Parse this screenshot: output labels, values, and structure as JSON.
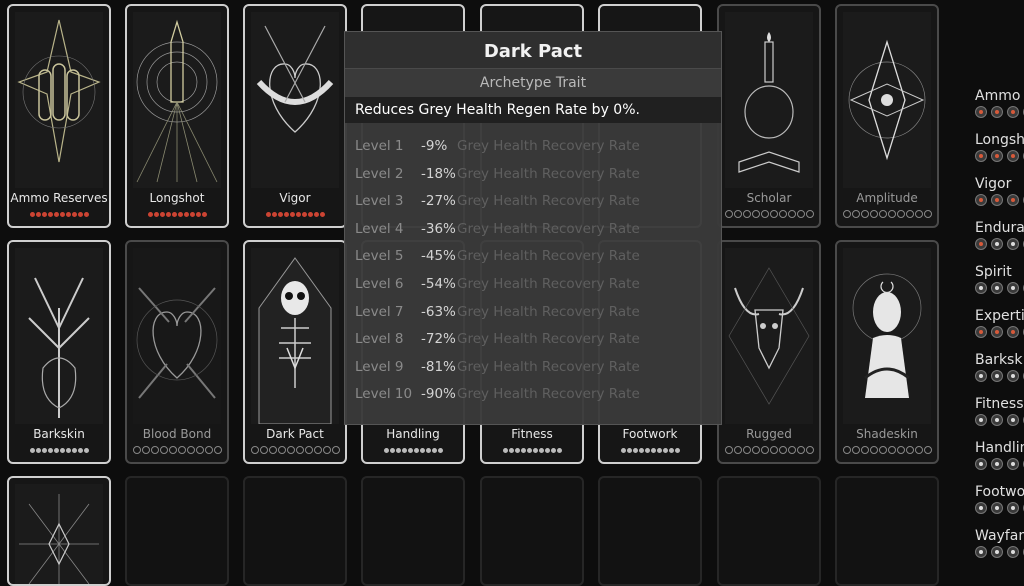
{
  "cards": [
    {
      "id": "ammo",
      "name": "Ammo Reserves",
      "state": "owned",
      "pips": "red10"
    },
    {
      "id": "longshot",
      "name": "Longshot",
      "state": "owned",
      "pips": "red10"
    },
    {
      "id": "vigor",
      "name": "Vigor",
      "state": "owned",
      "pips": "red10"
    },
    {
      "id": "hidden4",
      "name": "",
      "state": "owned",
      "pips": ""
    },
    {
      "id": "hidden5",
      "name": "",
      "state": "owned",
      "pips": ""
    },
    {
      "id": "hidden6",
      "name": "",
      "state": "owned",
      "pips": ""
    },
    {
      "id": "scholar",
      "name": "Scholar",
      "state": "unowned",
      "pips": "empty10"
    },
    {
      "id": "amplitude",
      "name": "Amplitude",
      "state": "unowned",
      "pips": "empty10"
    },
    {
      "id": "barkskin",
      "name": "Barkskin",
      "state": "owned",
      "pips": "small10"
    },
    {
      "id": "bloodbond",
      "name": "Blood Bond",
      "state": "unowned",
      "pips": "empty10"
    },
    {
      "id": "darkpact",
      "name": "Dark Pact",
      "state": "selected",
      "pips": "empty10"
    },
    {
      "id": "handling",
      "name": "Handling",
      "state": "owned",
      "pips": "small10"
    },
    {
      "id": "fitness",
      "name": "Fitness",
      "state": "owned",
      "pips": "small10"
    },
    {
      "id": "footwork",
      "name": "Footwork",
      "state": "owned",
      "pips": "small10"
    },
    {
      "id": "rugged",
      "name": "Rugged",
      "state": "unowned",
      "pips": "empty10"
    },
    {
      "id": "shadeskin",
      "name": "Shadeskin",
      "state": "unowned",
      "pips": "empty10"
    }
  ],
  "tooltip": {
    "title": "Dark Pact",
    "subtitle": "Archetype Trait",
    "description": "Reduces Grey Health Regen Rate by 0%.",
    "levels": [
      {
        "label": "Level 1",
        "value": "-9%",
        "desc": "Grey Health Recovery Rate"
      },
      {
        "label": "Level 2",
        "value": "-18%",
        "desc": "Grey Health Recovery Rate"
      },
      {
        "label": "Level 3",
        "value": "-27%",
        "desc": "Grey Health Recovery Rate"
      },
      {
        "label": "Level 4",
        "value": "-36%",
        "desc": "Grey Health Recovery Rate"
      },
      {
        "label": "Level 5",
        "value": "-45%",
        "desc": "Grey Health Recovery Rate"
      },
      {
        "label": "Level 6",
        "value": "-54%",
        "desc": "Grey Health Recovery Rate"
      },
      {
        "label": "Level 7",
        "value": "-63%",
        "desc": "Grey Health Recovery Rate"
      },
      {
        "label": "Level 8",
        "value": "-72%",
        "desc": "Grey Health Recovery Rate"
      },
      {
        "label": "Level 9",
        "value": "-81%",
        "desc": "Grey Health Recovery Rate"
      },
      {
        "label": "Level 10",
        "value": "-90%",
        "desc": "Grey Health Recovery Rate"
      }
    ]
  },
  "sidebar": [
    {
      "name": "Ammo",
      "dots": [
        "red",
        "red",
        "red",
        "red"
      ]
    },
    {
      "name": "Longsh",
      "dots": [
        "red",
        "red",
        "red",
        "red"
      ]
    },
    {
      "name": "Vigor",
      "dots": [
        "red",
        "red",
        "red",
        "red"
      ]
    },
    {
      "name": "Endura",
      "dots": [
        "red",
        "white",
        "white",
        "white"
      ]
    },
    {
      "name": "Spirit",
      "dots": [
        "white",
        "white",
        "white",
        "white"
      ]
    },
    {
      "name": "Experti",
      "dots": [
        "red",
        "red",
        "red",
        "red"
      ]
    },
    {
      "name": "Barksk",
      "dots": [
        "white",
        "white",
        "white",
        "white"
      ]
    },
    {
      "name": "Fitness",
      "dots": [
        "white",
        "white",
        "white",
        "white"
      ]
    },
    {
      "name": "Handlin",
      "dots": [
        "white",
        "white",
        "white",
        "white"
      ]
    },
    {
      "name": "Footwo",
      "dots": [
        "white",
        "white",
        "white",
        "white"
      ]
    },
    {
      "name": "Wayfar",
      "dots": [
        "white",
        "white",
        "white",
        "white"
      ]
    }
  ]
}
